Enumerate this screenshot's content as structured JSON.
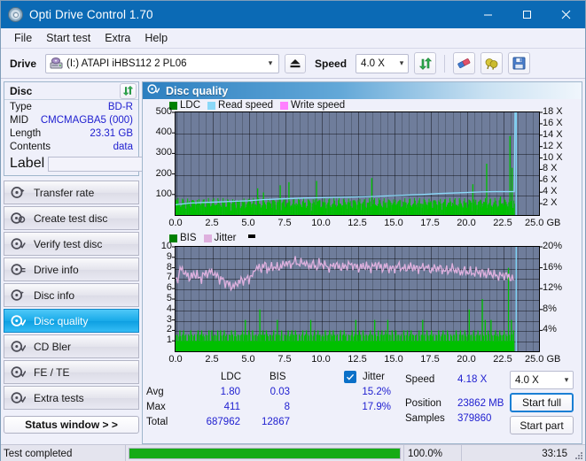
{
  "window": {
    "title": "Opti Drive Control 1.70",
    "icon": "disc-icon",
    "minimize": "minimize",
    "maximize": "maximize",
    "close": "close"
  },
  "menu": {
    "items": [
      "File",
      "Start test",
      "Extra",
      "Help"
    ]
  },
  "toolbar": {
    "drive_label": "Drive",
    "drive_value": "(I:)  ATAPI iHBS112  2 PL06",
    "eject_icon": "eject-icon",
    "speed_label": "Speed",
    "speed_value": "4.0 X",
    "refresh_icon": "refresh-icon",
    "eraser_icon": "eraser-icon",
    "bulb_icon": "bulb-icon",
    "save_icon": "save-icon"
  },
  "sidebar": {
    "disc_panel": {
      "title": "Disc",
      "refresh_icon": "refresh-icon",
      "rows": [
        {
          "key": "Type",
          "value": "BD-R"
        },
        {
          "key": "MID",
          "value": "CMCMAGBA5 (000)"
        },
        {
          "key": "Length",
          "value": "23.31 GB"
        },
        {
          "key": "Contents",
          "value": "data"
        }
      ],
      "label_key": "Label",
      "label_value": "",
      "label_placeholder": "",
      "label_button_icon": "disc-icon"
    },
    "nav": [
      {
        "label": "Transfer rate",
        "icon": "disc-speed-icon",
        "active": false
      },
      {
        "label": "Create test disc",
        "icon": "disc-burn-icon",
        "active": false
      },
      {
        "label": "Verify test disc",
        "icon": "disc-verify-icon",
        "active": false
      },
      {
        "label": "Drive info",
        "icon": "drive-info-icon",
        "active": false
      },
      {
        "label": "Disc info",
        "icon": "disc-info-icon",
        "active": false
      },
      {
        "label": "Disc quality",
        "icon": "disc-quality-icon",
        "active": true
      },
      {
        "label": "CD Bler",
        "icon": "cd-bler-icon",
        "active": false
      },
      {
        "label": "FE / TE",
        "icon": "fe-te-icon",
        "active": false
      },
      {
        "label": "Extra tests",
        "icon": "extra-tests-icon",
        "active": false
      }
    ],
    "status_window_button": "Status window > >"
  },
  "content": {
    "header_title": "Disc quality",
    "header_icon": "disc-quality-icon"
  },
  "stats": {
    "col_headers": [
      "LDC",
      "BIS"
    ],
    "row_headers": [
      "Avg",
      "Max",
      "Total"
    ],
    "ldc": {
      "avg": "1.80",
      "max": "411",
      "total": "687962"
    },
    "bis": {
      "avg": "0.03",
      "max": "8",
      "total": "12867"
    },
    "jitter": {
      "label": "Jitter",
      "checked": true,
      "avg": "15.2%",
      "max": "17.9%"
    },
    "speed": {
      "label": "Speed",
      "value": "4.18 X"
    },
    "position": {
      "label": "Position",
      "value": "23862 MB"
    },
    "samples": {
      "label": "Samples",
      "value": "379860"
    },
    "speed_select": "4.0 X",
    "start_full": "Start full",
    "start_part": "Start part"
  },
  "statusbar": {
    "message": "Test completed",
    "progress_percent": "100.0%",
    "progress_value": 100,
    "elapsed": "33:15"
  },
  "colors": {
    "accent": "#0b6ab5",
    "ldc_green": "#00c000",
    "read_speed_blue": "#8ad8f8",
    "write_speed_pink": "#ff80ff",
    "bis_green": "#00c000",
    "jitter_pink": "#deb0de",
    "plot_bg": "#6f7d9b",
    "progress_green": "#16ab16",
    "value_text": "#2020d0"
  },
  "chart_data": [
    {
      "type": "line",
      "title": "Disc quality - LDC / Read speed",
      "xlabel": "GB",
      "ylabel": "LDC",
      "xlim": [
        0,
        25
      ],
      "ylim": [
        0,
        500
      ],
      "y2lim": [
        0,
        18
      ],
      "y2label": "X",
      "grid": true,
      "legend": [
        {
          "name": "LDC",
          "color": "#008000"
        },
        {
          "name": "Read speed",
          "color": "#8ad8f8"
        },
        {
          "name": "Write speed",
          "color": "#ff80ff"
        }
      ],
      "xticks": [
        "0.0",
        "2.5",
        "5.0",
        "7.5",
        "10.0",
        "12.5",
        "15.0",
        "17.5",
        "20.0",
        "22.5",
        "25.0"
      ],
      "xtick_suffix": "GB",
      "yticks": [
        100,
        200,
        300,
        400,
        500
      ],
      "y2ticks": [
        "2 X",
        "4 X",
        "6 X",
        "8 X",
        "10 X",
        "12 X",
        "14 X",
        "16 X",
        "18 X"
      ],
      "data_end_gb": 23.31,
      "series": [
        {
          "name": "LDC",
          "color": "#00c000",
          "kind": "spikes",
          "x": [
            0.05,
            0.2,
            0.35,
            0.5,
            0.62,
            0.8,
            0.95,
            1.1,
            1.25,
            1.4,
            1.6,
            1.75,
            1.9,
            2.05,
            2.2,
            2.35,
            2.5,
            2.65,
            2.8,
            2.95,
            3.1,
            3.3,
            3.45,
            3.6,
            3.75,
            3.9,
            4.05,
            4.2,
            4.35,
            4.55,
            4.7,
            4.85,
            5.0,
            5.15,
            5.3,
            5.5,
            5.65,
            5.8,
            5.95,
            6.05,
            6.2,
            6.4,
            6.55,
            6.7,
            6.85,
            7.0,
            7.2,
            7.35,
            7.5,
            7.65,
            7.8,
            7.95,
            8.1,
            8.3,
            8.45,
            8.6,
            8.75,
            8.9,
            9.05,
            9.2,
            9.4,
            9.55,
            9.7,
            9.85,
            10.0,
            10.15,
            10.3,
            10.5,
            10.65,
            10.8,
            10.95,
            11.1,
            11.25,
            11.45,
            11.6,
            11.75,
            11.9,
            12.05,
            12.2,
            12.4,
            12.55,
            12.7,
            12.85,
            13.0,
            13.2,
            13.35,
            13.5,
            13.65,
            13.8,
            13.95,
            14.15,
            14.3,
            14.45,
            14.6,
            14.75,
            14.9,
            15.1,
            15.25,
            15.4,
            15.55,
            15.7,
            15.85,
            16.05,
            16.2,
            16.35,
            16.5,
            16.65,
            16.8,
            17.0,
            17.15,
            17.3,
            17.45,
            17.6,
            17.75,
            17.95,
            18.1,
            18.25,
            18.4,
            18.55,
            18.7,
            18.9,
            19.05,
            19.2,
            19.35,
            19.5,
            19.65,
            19.85,
            20.0,
            20.15,
            20.3,
            20.45,
            20.6,
            20.8,
            20.95,
            21.1,
            21.25,
            21.4,
            21.55,
            21.75,
            21.9,
            22.05,
            22.2,
            22.35,
            22.5,
            22.7,
            22.85,
            23.0,
            23.15,
            23.3
          ],
          "y": [
            75,
            50,
            40,
            58,
            35,
            42,
            60,
            38,
            45,
            52,
            36,
            48,
            62,
            40,
            44,
            55,
            38,
            42,
            50,
            36,
            46,
            58,
            40,
            52,
            38,
            44,
            60,
            36,
            48,
            42,
            55,
            38,
            46,
            64,
            40,
            52,
            130,
            44,
            38,
            110,
            48,
            42,
            56,
            38,
            50,
            62,
            145,
            44,
            38,
            52,
            160,
            46,
            40,
            58,
            42,
            50,
            64,
            38,
            44,
            56,
            40,
            48,
            166,
            42,
            38,
            54,
            46,
            60,
            38,
            44,
            52,
            40,
            58,
            46,
            38,
            50,
            62,
            44,
            40,
            56,
            38,
            48,
            52,
            42,
            60,
            38,
            180,
            46,
            40,
            54,
            44,
            38,
            50,
            62,
            42,
            48,
            38,
            56,
            44,
            40,
            52,
            60,
            38,
            46,
            50,
            42,
            58,
            38,
            54,
            44,
            48,
            40,
            62,
            38,
            52,
            46,
            40,
            56,
            42,
            50,
            38,
            60,
            44,
            48,
            40,
            54,
            38,
            46,
            52,
            60,
            150,
            44,
            50,
            38,
            56,
            42,
            250,
            48,
            40,
            62,
            52,
            44,
            90,
            58,
            50,
            42,
            385,
            230,
            55,
            95,
            120
          ]
        },
        {
          "name": "Read speed",
          "color": "#8ad8f8",
          "kind": "line",
          "x": [
            0.0,
            1.0,
            2.0,
            3.0,
            4.0,
            5.0,
            6.0,
            7.0,
            8.0,
            9.0,
            10.0,
            11.0,
            12.0,
            13.0,
            14.0,
            15.0,
            16.0,
            17.0,
            18.0,
            19.0,
            20.0,
            21.0,
            22.0,
            23.0,
            23.3,
            23.35
          ],
          "y_speed": [
            1.8,
            2.1,
            2.2,
            2.3,
            2.4,
            2.5,
            2.7,
            2.8,
            2.9,
            3.0,
            3.05,
            3.1,
            3.15,
            3.2,
            3.3,
            3.4,
            3.5,
            3.6,
            3.75,
            3.85,
            3.95,
            4.05,
            4.1,
            4.1,
            4.1,
            18.0
          ]
        }
      ]
    },
    {
      "type": "line",
      "title": "Disc quality - BIS / Jitter",
      "xlabel": "GB",
      "ylabel": "BIS",
      "xlim": [
        0,
        25
      ],
      "ylim": [
        0,
        10
      ],
      "y2lim": [
        0,
        20
      ],
      "y2label": "%",
      "grid": true,
      "legend": [
        {
          "name": "BIS",
          "color": "#008000"
        },
        {
          "name": "Jitter",
          "color": "#deb0de"
        }
      ],
      "xticks": [
        "0.0",
        "2.5",
        "5.0",
        "7.5",
        "10.0",
        "12.5",
        "15.0",
        "17.5",
        "20.0",
        "22.5",
        "25.0"
      ],
      "xtick_suffix": "GB",
      "yticks": [
        1,
        2,
        3,
        4,
        5,
        6,
        7,
        8,
        9,
        10
      ],
      "y2ticks": [
        "4%",
        "8%",
        "12%",
        "16%",
        "20%"
      ],
      "data_end_gb": 23.31,
      "series": [
        {
          "name": "BIS",
          "color": "#00c000",
          "kind": "spikes",
          "baseline": 1,
          "x": [
            0.3,
            0.55,
            0.8,
            1.05,
            1.3,
            1.55,
            1.8,
            2.05,
            2.3,
            2.5,
            2.7,
            2.9,
            3.1,
            3.35,
            3.6,
            3.85,
            4.1,
            4.35,
            4.6,
            4.8,
            5.05,
            5.3,
            5.55,
            5.8,
            6.0,
            6.25,
            6.5,
            6.75,
            7.0,
            7.3,
            7.5,
            7.75,
            8.0,
            8.25,
            8.5,
            8.75,
            9.0,
            9.3,
            9.55,
            9.8,
            10.05,
            10.3,
            10.6,
            10.85,
            11.1,
            11.35,
            11.6,
            11.9,
            12.15,
            12.4,
            12.65,
            12.9,
            13.15,
            13.4,
            13.7,
            13.95,
            14.2,
            14.45,
            14.6,
            14.9,
            15.15,
            15.4,
            15.7,
            15.95,
            16.2,
            16.5,
            16.75,
            17.0,
            17.3,
            17.6,
            17.85,
            18.1,
            18.4,
            18.7,
            19.0,
            19.3,
            19.6,
            19.9,
            20.2,
            20.5,
            20.8,
            21.1,
            21.3,
            21.5,
            21.7,
            22.0,
            22.3,
            22.6,
            22.9,
            23.1,
            23.25
          ],
          "y": [
            2,
            2,
            1,
            2,
            1,
            2,
            2,
            1,
            2,
            2,
            1,
            2,
            2,
            2,
            1,
            2,
            2,
            1,
            2,
            3,
            2,
            2,
            1,
            4,
            2,
            2,
            1,
            2,
            3,
            2,
            1,
            2,
            2,
            2,
            1,
            2,
            2,
            3,
            2,
            2,
            1,
            2,
            2,
            2,
            1,
            2,
            2,
            1,
            2,
            3,
            2,
            2,
            1,
            2,
            3,
            2,
            2,
            2,
            3,
            2,
            2,
            1,
            2,
            2,
            2,
            1,
            2,
            3,
            2,
            2,
            1,
            2,
            2,
            2,
            1,
            2,
            2,
            2,
            4,
            2,
            2,
            5,
            3,
            2,
            3,
            2,
            2,
            2,
            8,
            3,
            2
          ]
        },
        {
          "name": "Jitter",
          "color": "#deb0de",
          "kind": "line",
          "unit": "%",
          "x": [
            0.0,
            0.3,
            0.6,
            0.9,
            1.2,
            1.5,
            1.8,
            2.1,
            2.4,
            2.7,
            3.0,
            3.3,
            3.6,
            3.9,
            4.2,
            4.5,
            4.8,
            5.0,
            5.3,
            5.6,
            5.9,
            6.2,
            6.5,
            6.8,
            7.1,
            7.4,
            7.7,
            8.0,
            8.3,
            8.6,
            8.9,
            9.2,
            9.5,
            9.8,
            10.1,
            10.4,
            10.7,
            11.0,
            11.3,
            11.6,
            11.9,
            12.2,
            12.5,
            12.8,
            13.1,
            13.4,
            13.7,
            14.0,
            14.3,
            14.6,
            14.9,
            15.2,
            15.5,
            15.8,
            16.1,
            16.4,
            16.7,
            17.0,
            17.3,
            17.6,
            17.9,
            18.2,
            18.5,
            18.8,
            19.1,
            19.4,
            19.7,
            20.0,
            20.3,
            20.6,
            20.9,
            21.2,
            21.5,
            21.8,
            22.1,
            22.4,
            22.7,
            23.0,
            23.3
          ],
          "y": [
            7.0,
            7.9,
            7.3,
            7.1,
            7.4,
            7.0,
            7.3,
            7.5,
            7.6,
            7.2,
            6.9,
            6.6,
            6.3,
            6.2,
            6.6,
            6.8,
            6.9,
            7.2,
            8.0,
            7.9,
            8.2,
            7.9,
            8.1,
            8.0,
            8.2,
            8.5,
            8.3,
            8.6,
            8.4,
            8.5,
            8.2,
            8.3,
            8.1,
            8.4,
            8.2,
            8.0,
            8.3,
            8.1,
            8.0,
            8.2,
            8.3,
            8.1,
            8.0,
            8.2,
            8.0,
            8.1,
            8.3,
            8.0,
            8.1,
            7.9,
            8.0,
            8.2,
            7.9,
            8.0,
            8.1,
            7.9,
            8.0,
            8.1,
            7.8,
            7.9,
            8.0,
            7.8,
            7.7,
            7.9,
            7.8,
            7.6,
            7.7,
            7.6,
            7.5,
            7.6,
            7.5,
            7.4,
            7.5,
            7.3,
            7.2,
            7.3,
            7.2,
            6.9,
            7.1
          ]
        }
      ]
    }
  ]
}
